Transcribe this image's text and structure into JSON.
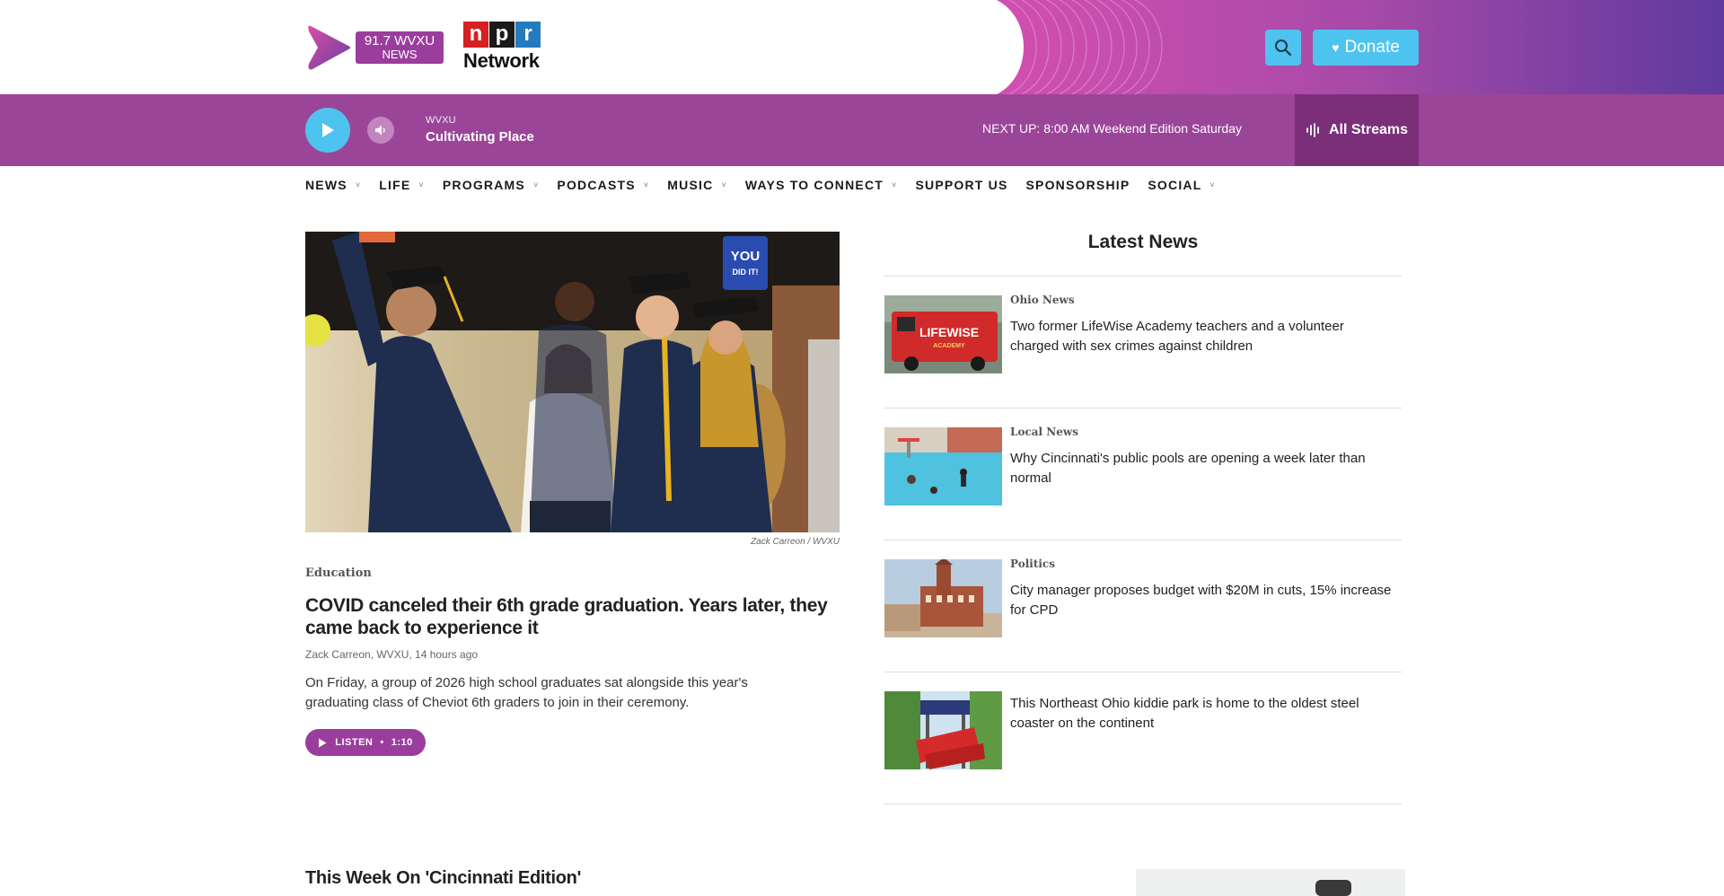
{
  "header": {
    "logo": {
      "line1": "91.7 WVXU",
      "line2": "NEWS"
    },
    "npr": {
      "letters": [
        "n",
        "p",
        "r"
      ],
      "network": "Network"
    },
    "donate_label": "Donate",
    "colors": {
      "accent": "#4fc3f0",
      "brand": "#9b3d9c"
    }
  },
  "player": {
    "station": "WVXU",
    "show": "Cultivating Place",
    "next_up_label": "NEXT UP:",
    "next_up_time": "8:00 AM",
    "next_up_show": "Weekend Edition Saturday",
    "streams_label": "All Streams"
  },
  "nav": [
    {
      "label": "NEWS",
      "has_menu": true
    },
    {
      "label": "LIFE",
      "has_menu": true
    },
    {
      "label": "PROGRAMS",
      "has_menu": true
    },
    {
      "label": "PODCASTS",
      "has_menu": true
    },
    {
      "label": "MUSIC",
      "has_menu": true
    },
    {
      "label": "WAYS TO CONNECT",
      "has_menu": true
    },
    {
      "label": "SUPPORT US",
      "has_menu": false
    },
    {
      "label": "SPONSORSHIP",
      "has_menu": false
    },
    {
      "label": "SOCIAL",
      "has_menu": true
    }
  ],
  "main_story": {
    "photo_credit": "Zack Carreon  /  WVXU",
    "sign_text": "YOU DID IT!",
    "category": "Education",
    "headline": "COVID canceled their 6th grade graduation. Years later, they came back to experience it",
    "byline": "Zack Carreon, WVXU, 14 hours ago",
    "teaser": "On Friday, a group of 2026 high school graduates sat alongside this year's graduating class of Cheviot 6th graders to join in their ceremony.",
    "listen_label": "LISTEN",
    "listen_duration": "1:10"
  },
  "latest": {
    "title": "Latest News",
    "items": [
      {
        "category": "Ohio News",
        "headline": "Two former LifeWise Academy teachers and a volunteer charged with sex crimes against children",
        "thumb_text": "LIFEWISE",
        "thumb_subtext": "ACADEMY"
      },
      {
        "category": "Local News",
        "headline": "Why Cincinnati's public pools are opening a week later than normal"
      },
      {
        "category": "Politics",
        "headline": "City manager proposes budget with $20M in cuts, 15% increase for CPD"
      },
      {
        "category": "",
        "headline": "This Northeast Ohio kiddie park is home to the oldest steel coaster on the continent"
      }
    ]
  },
  "section": {
    "title": "This Week On 'Cincinnati Edition'"
  }
}
